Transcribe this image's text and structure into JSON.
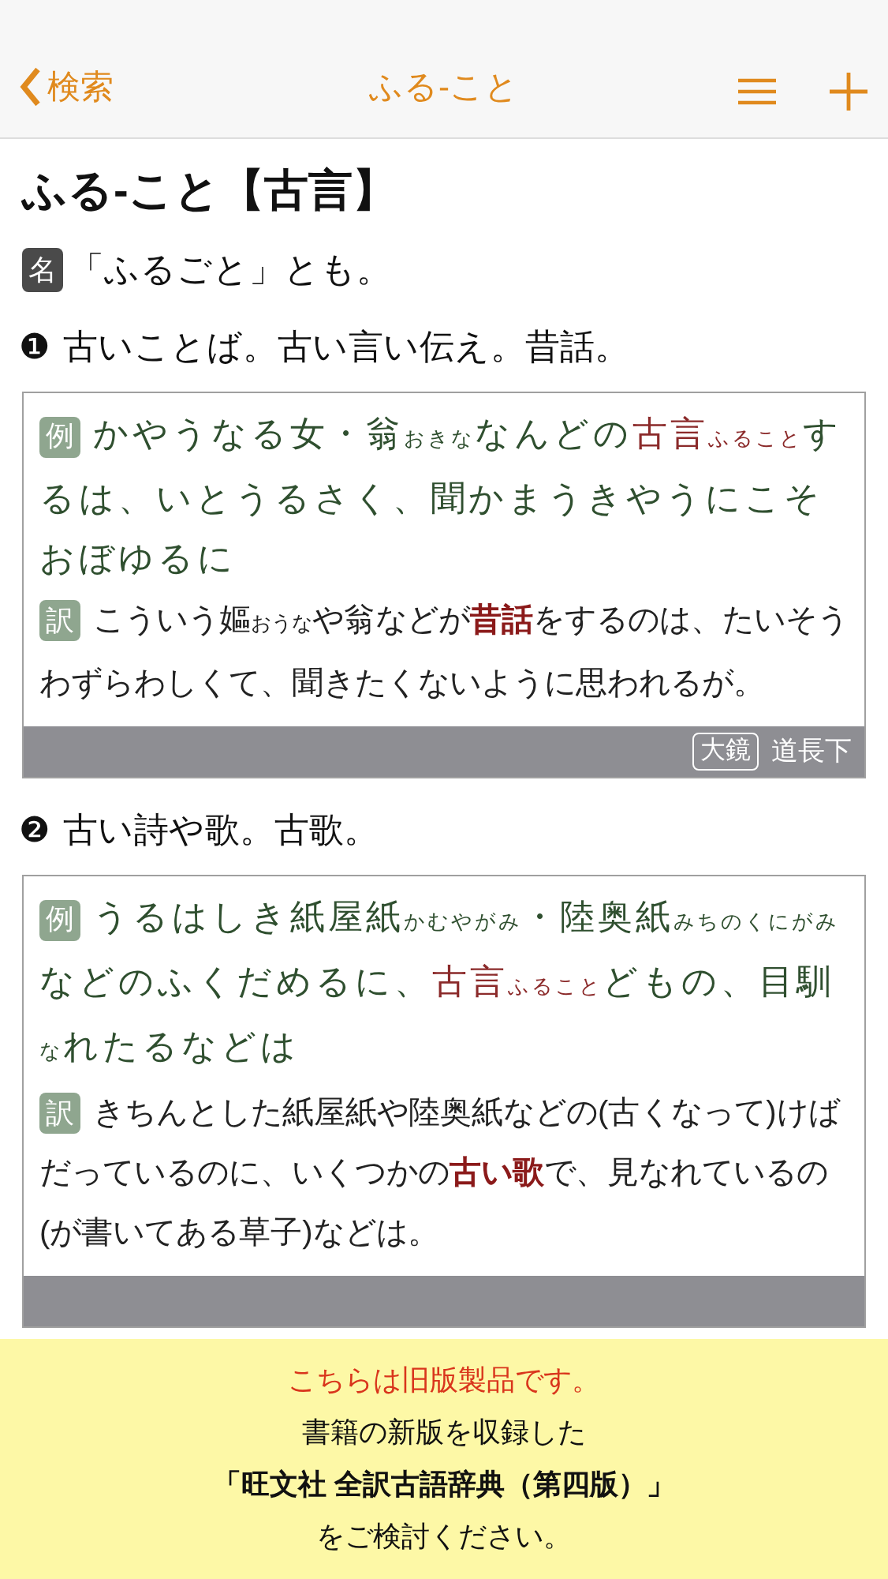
{
  "nav": {
    "back": "検索",
    "title": "ふる-こと"
  },
  "entry": {
    "headword": "ふる-こと【古言】",
    "pos": "名",
    "note": "「ふるごと」とも。",
    "senses": [
      {
        "marker": "❶",
        "definition": "古いことば。古い言い伝え。昔話。",
        "example_label": "例",
        "example": [
          {
            "kind": "plain",
            "text": "かやうなる女・翁"
          },
          {
            "kind": "reading",
            "text": "おきな"
          },
          {
            "kind": "plain",
            "text": "なんどの"
          },
          {
            "kind": "highlight",
            "text": "古言"
          },
          {
            "kind": "highlight_reading",
            "text": "ふること"
          },
          {
            "kind": "plain",
            "text": "するは、いとうるさく、聞かまうきやうにこそおぼゆるに"
          }
        ],
        "translation_label": "訳",
        "translation": [
          {
            "kind": "plain",
            "text": "こういう嫗"
          },
          {
            "kind": "reading",
            "text": "おうな"
          },
          {
            "kind": "plain",
            "text": "や翁などが"
          },
          {
            "kind": "emphasis",
            "text": "昔話"
          },
          {
            "kind": "plain",
            "text": "をするのは、たいそうわずらわしくて、聞きたくないように思われるが。"
          }
        ],
        "source_book": "大鏡",
        "source_chapter": "道長下"
      },
      {
        "marker": "❷",
        "definition": "古い詩や歌。古歌。",
        "example_label": "例",
        "example": [
          {
            "kind": "plain",
            "text": "うるはしき紙屋紙"
          },
          {
            "kind": "reading",
            "text": "かむやがみ"
          },
          {
            "kind": "plain",
            "text": "・陸奥紙"
          },
          {
            "kind": "reading",
            "text": "みちのくにがみ"
          },
          {
            "kind": "plain",
            "text": "などのふくだめるに、"
          },
          {
            "kind": "highlight",
            "text": "古言"
          },
          {
            "kind": "highlight_reading",
            "text": "ふること"
          },
          {
            "kind": "plain",
            "text": "どもの、目馴"
          },
          {
            "kind": "reading",
            "text": "な"
          },
          {
            "kind": "plain",
            "text": "れたるなどは"
          }
        ],
        "translation_label": "訳",
        "translation": [
          {
            "kind": "plain",
            "text": "きちんとした紙屋紙や陸奥紙などの(古くなって)けばだっているのに、いくつかの"
          },
          {
            "kind": "emphasis",
            "text": "古い歌"
          },
          {
            "kind": "plain",
            "text": "で、見なれているの(が書いてある草子)などは。"
          }
        ]
      }
    ]
  },
  "notice": {
    "warning": "こちらは旧版製品です。",
    "line_1": "書籍の新版を収録した",
    "product": "「旺文社 全訳古語辞典（第四版）」",
    "line_2": "をご検討ください。"
  }
}
